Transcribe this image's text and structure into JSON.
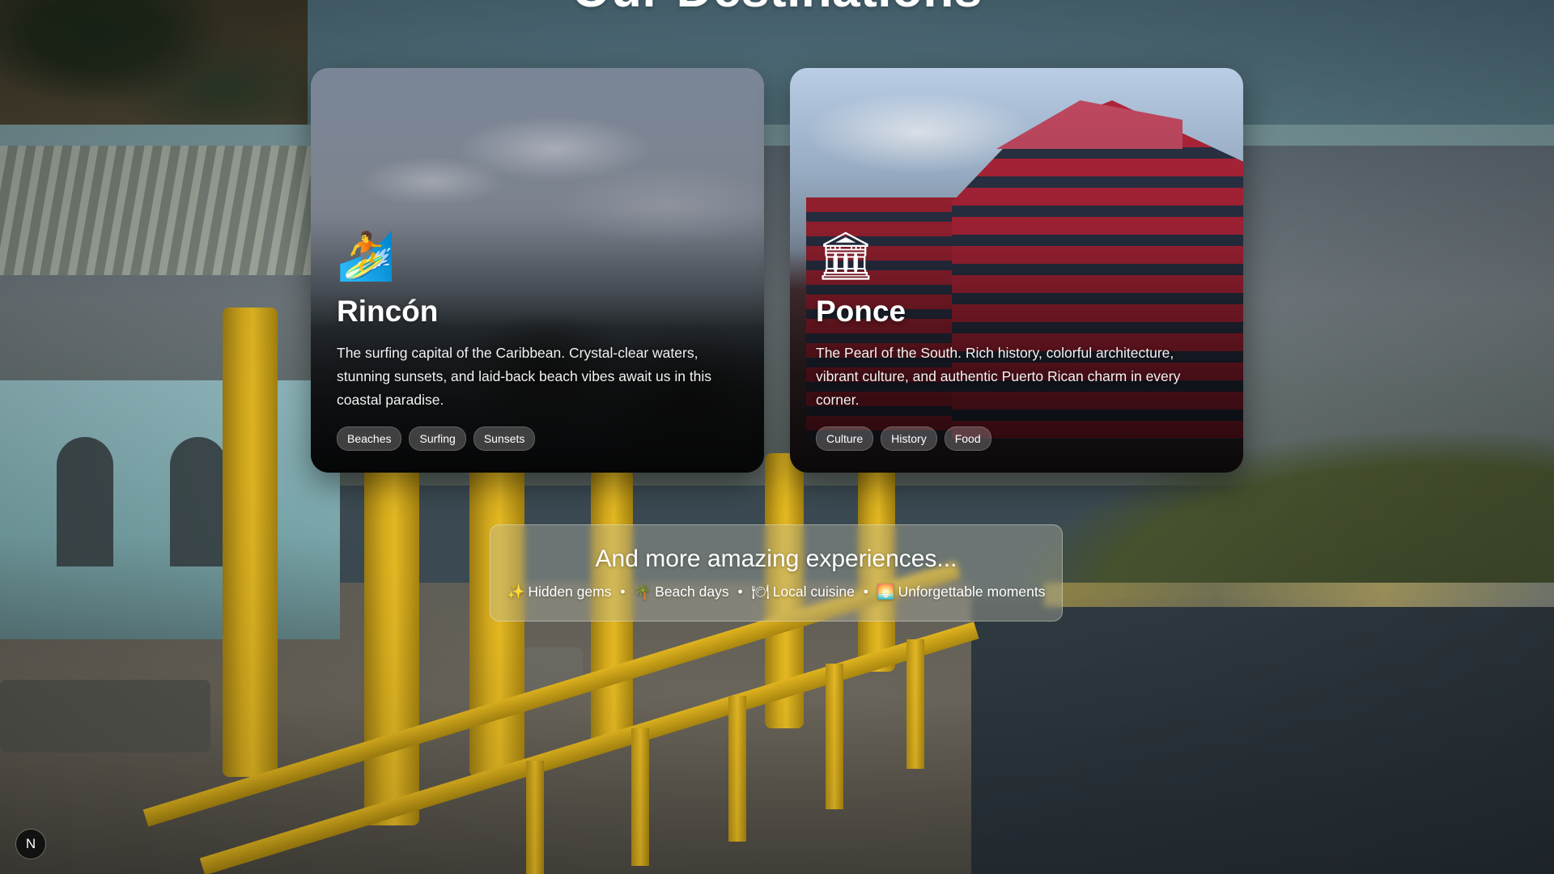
{
  "section": {
    "title": "Our Destinations"
  },
  "destinations": [
    {
      "icon": "surfer-icon",
      "emoji": "🏄",
      "name": "Rincón",
      "description": "The surfing capital of the Caribbean. Crystal-clear waters, stunning sunsets, and laid-back beach vibes await us in this coastal paradise.",
      "tags": [
        "Beaches",
        "Surfing",
        "Sunsets"
      ]
    },
    {
      "icon": "classical-building-icon",
      "emoji": "🏛",
      "name": "Ponce",
      "description": "The Pearl of the South. Rich history, colorful architecture, vibrant culture, and authentic Puerto Rican charm in every corner.",
      "tags": [
        "Culture",
        "History",
        "Food"
      ]
    }
  ],
  "more": {
    "title": "And more amazing experiences...",
    "items": [
      {
        "icon": "sparkles-icon",
        "emoji": "✨",
        "label": "Hidden gems"
      },
      {
        "icon": "palm-tree-icon",
        "emoji": "🌴",
        "label": "Beach days"
      },
      {
        "icon": "plate-icon",
        "emoji": "🍽",
        "label": "Local cuisine"
      },
      {
        "icon": "sunset-icon",
        "emoji": "🌅",
        "label": "Unforgettable moments"
      }
    ],
    "separator": "•"
  },
  "badge": {
    "label": "N"
  },
  "colors": {
    "tag_bg": "rgba(255,255,255,0.22)",
    "text": "#ffffff",
    "badge_bg": "#111111"
  }
}
